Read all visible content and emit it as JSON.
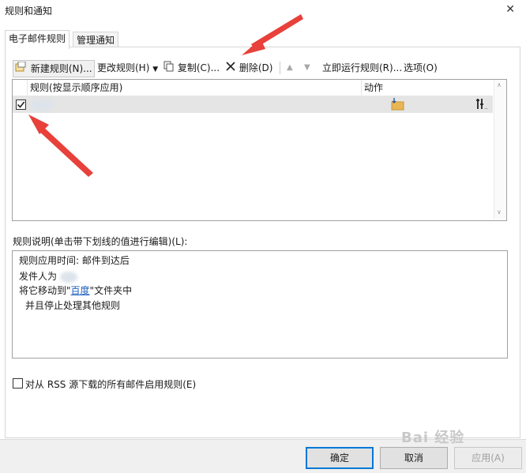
{
  "window": {
    "title": "规则和通知"
  },
  "tabs": [
    {
      "label": "电子邮件规则",
      "active": true
    },
    {
      "label": "管理通知",
      "active": false
    }
  ],
  "toolbar": {
    "new_rule": "新建规则(N)...",
    "change_rule": "更改规则(H)",
    "copy": "复制(C)...",
    "delete": "删除(D)",
    "run_rules": "立即运行规则(R)...",
    "options": "选项(O)"
  },
  "rules_list": {
    "col_rule": "规则(按显示顺序应用)",
    "col_action": "动作",
    "rows": [
      {
        "checked": true,
        "name": ""
      }
    ]
  },
  "description": {
    "label": "规则说明(单击带下划线的值进行编辑)(L):",
    "line1": "规则应用时间: 邮件到达后",
    "line2_prefix": "发件人为",
    "line3_prefix": "将它移动到\"",
    "line3_link": "百度",
    "line3_suffix": "\"文件夹中",
    "line4": "并且停止处理其他规则"
  },
  "rss_checkbox": {
    "label": "对从 RSS 源下载的所有邮件启用规则(E)",
    "checked": false
  },
  "footer": {
    "ok": "确定",
    "cancel": "取消",
    "apply": "应用(A)"
  },
  "watermark": {
    "text": "Bai 经验"
  },
  "colors": {
    "arrow": "#e8403a",
    "link": "#1d5fbf",
    "selected_row": "#e5e5e5",
    "ok_border": "#0078d7"
  }
}
